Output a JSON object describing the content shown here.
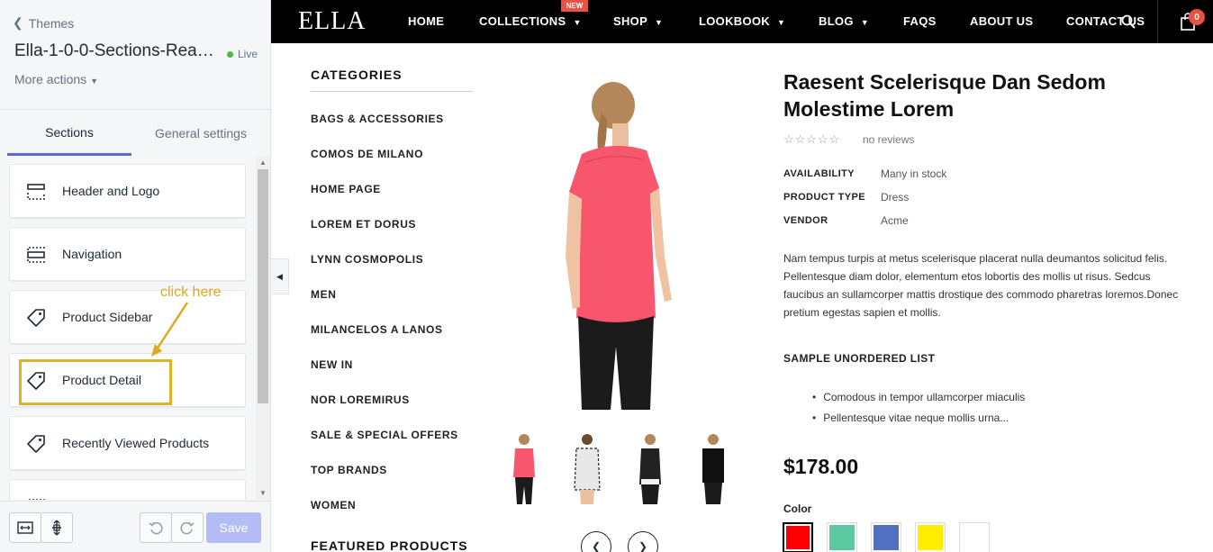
{
  "editor": {
    "back_label": "Themes",
    "theme_name": "Ella-1-0-0-Sections-Rea…",
    "live_label": "Live",
    "more_actions": "More actions",
    "tabs": [
      {
        "label": "Sections",
        "active": true
      },
      {
        "label": "General settings",
        "active": false
      }
    ],
    "sections": [
      {
        "label": "Header and Logo",
        "icon": "header-layout-icon"
      },
      {
        "label": "Navigation",
        "icon": "navigation-layout-icon"
      },
      {
        "label": "Product Sidebar",
        "icon": "tag-icon"
      },
      {
        "label": "Product Detail",
        "icon": "tag-icon"
      },
      {
        "label": "Recently Viewed Products",
        "icon": "tag-icon"
      }
    ],
    "annotation": "click here",
    "save_label": "Save",
    "accent_color": "#5c6ac4",
    "highlight_color": "#e2b12a"
  },
  "store": {
    "logo": "ELLA",
    "nav": [
      {
        "label": "HOME",
        "dropdown": false
      },
      {
        "label": "COLLECTIONS",
        "dropdown": true
      },
      {
        "label": "SHOP",
        "dropdown": true
      },
      {
        "label": "LOOKBOOK",
        "dropdown": true
      },
      {
        "label": "BLOG",
        "dropdown": true
      },
      {
        "label": "FAQS",
        "dropdown": false
      },
      {
        "label": "ABOUT US",
        "dropdown": false
      },
      {
        "label": "CONTACT US",
        "dropdown": false
      }
    ],
    "new_badge": "NEW",
    "cart_count": "0",
    "categories_title": "CATEGORIES",
    "categories": [
      "BAGS & ACCESSORIES",
      "COMOS DE MILANO",
      "HOME PAGE",
      "LOREM ET DORUS",
      "LYNN COSMOPOLIS",
      "MEN",
      "MILANCELOS A LANOS",
      "NEW IN",
      "NOR LOREMIRUS",
      "SALE & SPECIAL OFFERS",
      "TOP BRANDS",
      "WOMEN"
    ],
    "featured_title": "FEATURED PRODUCTS",
    "product": {
      "title": "Raesent Scelerisque Dan Sedom Molestime Lorem",
      "rating": 0,
      "reviews": "no reviews",
      "meta": [
        {
          "key": "AVAILABILITY",
          "value": "Many in stock"
        },
        {
          "key": "PRODUCT TYPE",
          "value": "Dress"
        },
        {
          "key": "VENDOR",
          "value": "Acme"
        }
      ],
      "description": "Nam tempus turpis at metus scelerisque placerat nulla deumantos solicitud felis. Pellentesque diam dolor, elementum etos lobortis des mollis ut risus. Sedcus faucibus an sullamcorper mattis drostique des commodo pharetras loremos.Donec pretium egestas sapien et mollis.",
      "list_title": "SAMPLE UNORDERED LIST",
      "list_items": [
        "Comodous in tempor ullamcorper miaculis",
        "Pellentesque vitae neque mollis urna..."
      ],
      "price": "$178.00",
      "color_label": "Color",
      "colors": [
        "#ff0000",
        "#5cc8a0",
        "#5470c0",
        "#ffee00",
        "#ffffff"
      ]
    }
  }
}
